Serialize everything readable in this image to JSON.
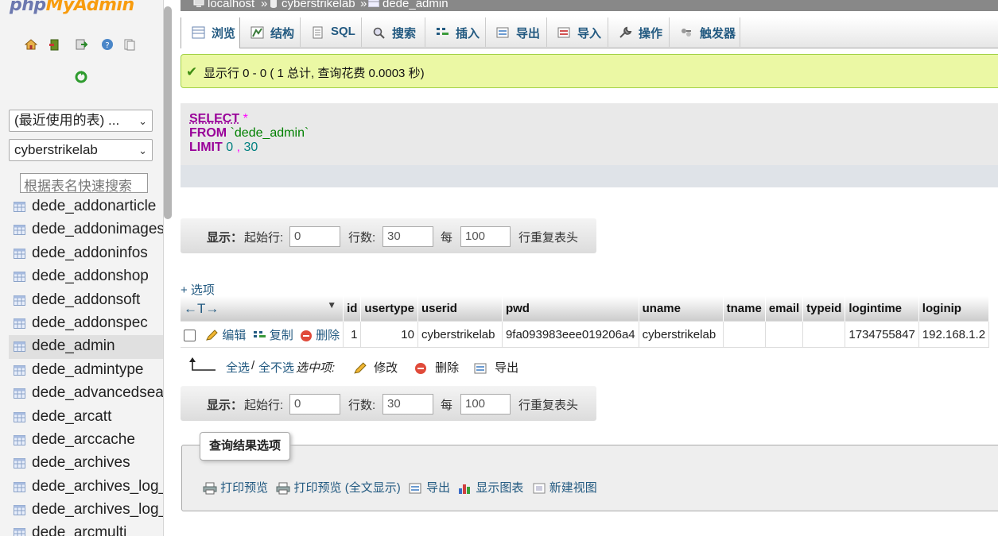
{
  "app": {
    "logo_php": "php",
    "logo_my": "My",
    "logo_admin": "Admin"
  },
  "sidebar": {
    "recent_select": "(最近使用的表) ...",
    "db_select": "cyberstrikelab",
    "filter_placeholder": "根据表名快速搜索",
    "tables": [
      {
        "name": "dede_addonarticle"
      },
      {
        "name": "dede_addonimages"
      },
      {
        "name": "dede_addoninfos"
      },
      {
        "name": "dede_addonshop"
      },
      {
        "name": "dede_addonsoft"
      },
      {
        "name": "dede_addonspec"
      },
      {
        "name": "dede_admin"
      },
      {
        "name": "dede_admintype"
      },
      {
        "name": "dede_advancedsear"
      },
      {
        "name": "dede_arcatt"
      },
      {
        "name": "dede_arccache"
      },
      {
        "name": "dede_archives"
      },
      {
        "name": "dede_archives_log_"
      },
      {
        "name": "dede_archives_log_"
      },
      {
        "name": "dede_arcmulti"
      }
    ],
    "active_table": "dede_admin"
  },
  "breadcrumb": {
    "server": "localhost",
    "sep1": "»",
    "database": "cyberstrikelab",
    "sep2": "»",
    "table": "dede_admin"
  },
  "tabs": [
    {
      "label": "浏览",
      "icon": "browse-icon"
    },
    {
      "label": "结构",
      "icon": "structure-icon"
    },
    {
      "label": "SQL",
      "icon": "sql-icon"
    },
    {
      "label": "搜索",
      "icon": "search-icon"
    },
    {
      "label": "插入",
      "icon": "insert-icon"
    },
    {
      "label": "导出",
      "icon": "export-icon"
    },
    {
      "label": "导入",
      "icon": "import-icon"
    },
    {
      "label": "操作",
      "icon": "wrench-icon"
    },
    {
      "label": "触发器",
      "icon": "trigger-icon"
    }
  ],
  "message": {
    "text": "显示行 0 - 0 ( 1 总计, 查询花费 0.0003 秒)"
  },
  "sql": {
    "select": "SELECT",
    "star": "*",
    "from": "FROM",
    "table": "`dede_admin`",
    "limit": "LIMIT",
    "offset": "0",
    "comma": ",",
    "count": "30"
  },
  "nav": {
    "show_label": "显示：",
    "start_label": "起始行:",
    "start_value": "0",
    "rows_label": "行数:",
    "rows_value": "30",
    "every_label": "每",
    "every_value": "100",
    "repeat_label": "行重复表头"
  },
  "options_link": "+ 选项",
  "results": {
    "arrows": "←T→",
    "sort_icon": "▼",
    "columns": [
      "id",
      "usertype",
      "userid",
      "pwd",
      "uname",
      "tname",
      "email",
      "typeid",
      "logintime",
      "loginip"
    ],
    "row_actions": {
      "edit": "编辑",
      "copy": "复制",
      "delete": "删除"
    },
    "rows": [
      {
        "id": "1",
        "usertype": "10",
        "userid": "cyberstrikelab",
        "pwd": "9fa093983eee019206a4",
        "uname": "cyberstrikelab",
        "tname": "",
        "email": "",
        "typeid": "",
        "logintime": "1734755847",
        "loginip": "192.168.1.2"
      }
    ]
  },
  "bulk": {
    "check_all": "全选",
    "slash": "/",
    "uncheck_all": "全不选",
    "with_selected": "选中项:",
    "edit": "修改",
    "delete": "删除",
    "export": "导出"
  },
  "query_ops": {
    "legend": "查询结果选项",
    "print_preview": "打印预览",
    "print_full": "打印预览 (全文显示)",
    "export": "导出",
    "chart": "显示图表",
    "create_view": "新建视图"
  }
}
